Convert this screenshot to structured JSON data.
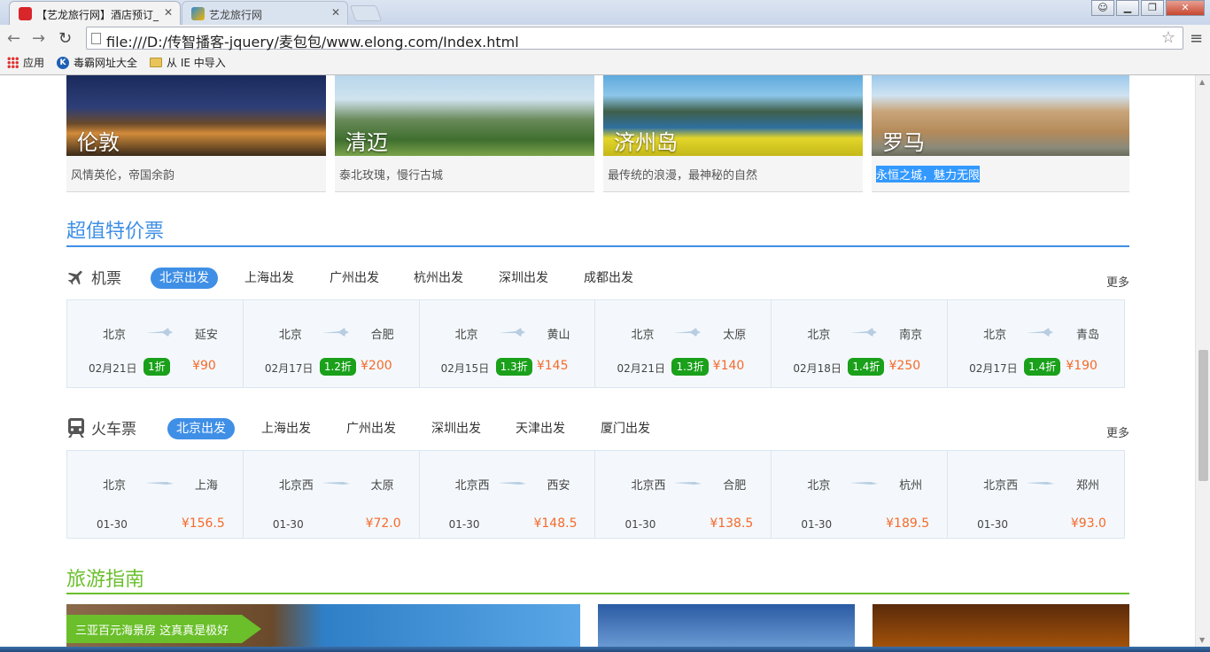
{
  "browser": {
    "tabs": [
      {
        "title": "【艺龙旅行网】酒店预订_",
        "active": true
      },
      {
        "title": "艺龙旅行网",
        "active": false
      }
    ],
    "url": "file:///D:/传智播客-jquery/麦包包/www.elong.com/Index.html",
    "bookmarks": [
      "应用",
      "毒霸网址大全",
      "从 IE 中导入"
    ]
  },
  "cities": [
    {
      "name": "伦敦",
      "desc": "风情英伦，帝国余韵"
    },
    {
      "name": "清迈",
      "desc": "泰北玫瑰，慢行古城"
    },
    {
      "name": "济州岛",
      "desc": "最传统的浪漫，最神秘的自然"
    },
    {
      "name": "罗马",
      "desc": "永恒之城，魅力无限"
    }
  ],
  "deals": {
    "title": "超值特价票",
    "flights": {
      "label": "机票",
      "tabs": [
        "北京出发",
        "上海出发",
        "广州出发",
        "杭州出发",
        "深圳出发",
        "成都出发"
      ],
      "more": "更多",
      "items": [
        {
          "from": "北京",
          "to": "延安",
          "date": "02月21日",
          "discount": "1折",
          "price": "¥90"
        },
        {
          "from": "北京",
          "to": "合肥",
          "date": "02月17日",
          "discount": "1.2折",
          "price": "¥200"
        },
        {
          "from": "北京",
          "to": "黄山",
          "date": "02月15日",
          "discount": "1.3折",
          "price": "¥145"
        },
        {
          "from": "北京",
          "to": "太原",
          "date": "02月21日",
          "discount": "1.3折",
          "price": "¥140"
        },
        {
          "from": "北京",
          "to": "南京",
          "date": "02月18日",
          "discount": "1.4折",
          "price": "¥250"
        },
        {
          "from": "北京",
          "to": "青岛",
          "date": "02月17日",
          "discount": "1.4折",
          "price": "¥190"
        }
      ]
    },
    "trains": {
      "label": "火车票",
      "tabs": [
        "北京出发",
        "上海出发",
        "广州出发",
        "深圳出发",
        "天津出发",
        "厦门出发"
      ],
      "more": "更多",
      "items": [
        {
          "from": "北京",
          "to": "上海",
          "date": "01-30",
          "price": "¥156.5"
        },
        {
          "from": "北京西",
          "to": "太原",
          "date": "01-30",
          "price": "¥72.0"
        },
        {
          "from": "北京西",
          "to": "西安",
          "date": "01-30",
          "price": "¥148.5"
        },
        {
          "from": "北京西",
          "to": "合肥",
          "date": "01-30",
          "price": "¥138.5"
        },
        {
          "from": "北京",
          "to": "杭州",
          "date": "01-30",
          "price": "¥189.5"
        },
        {
          "from": "北京西",
          "to": "郑州",
          "date": "01-30",
          "price": "¥93.0"
        }
      ]
    }
  },
  "guide": {
    "title": "旅游指南",
    "featured": "三亚百元海景房 这真真是极好"
  },
  "colors": {
    "deals_accent": "#3f8fe6",
    "guide_accent": "#6abf2a",
    "price": "#f46a2c",
    "discount": "#1aa01a"
  }
}
